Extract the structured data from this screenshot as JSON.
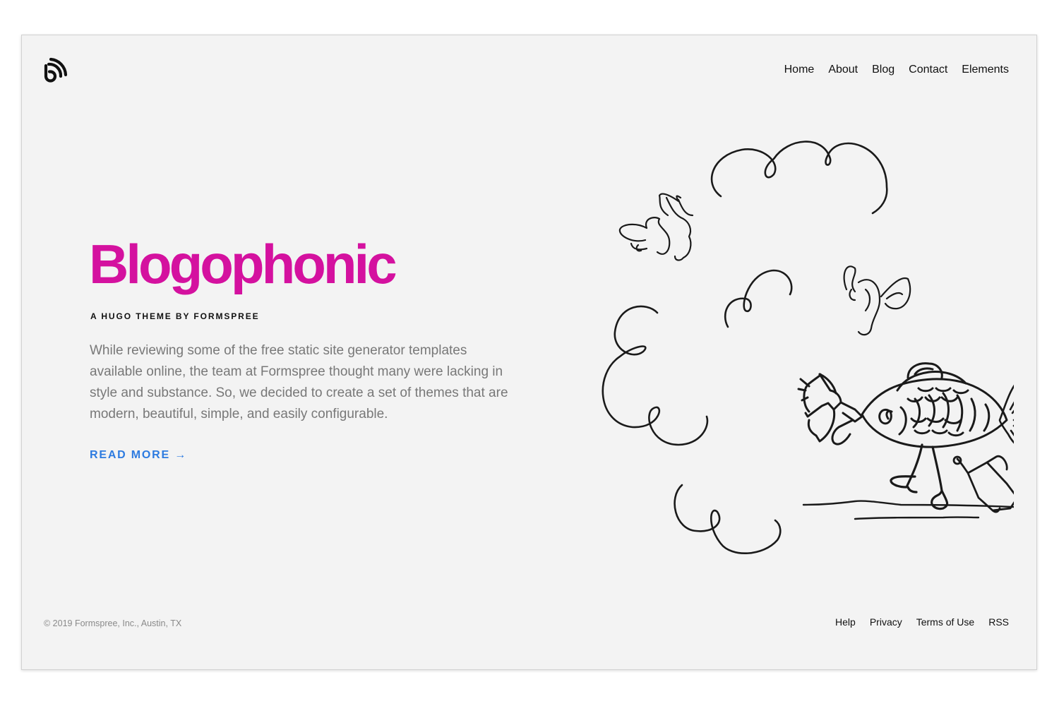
{
  "header": {
    "logo_icon": "rss-feed-icon",
    "nav": [
      {
        "label": "Home"
      },
      {
        "label": "About"
      },
      {
        "label": "Blog"
      },
      {
        "label": "Contact"
      },
      {
        "label": "Elements"
      }
    ]
  },
  "hero": {
    "title": "Blogophonic",
    "subtitle": "A HUGO THEME BY FORMSPREE",
    "description": "While reviewing some of the free static site generator templates available online, the team at Formspree thought many were lacking in style and substance. So, we decided to create a set of themes that are modern, beautiful, simple, and easily configurable.",
    "read_more_label": "READ MORE →"
  },
  "illustration": {
    "icon": "fish-megaphone-illustration"
  },
  "footer": {
    "copyright": "© 2019 Formspree, Inc., Austin, TX",
    "links": [
      {
        "label": "Help"
      },
      {
        "label": "Privacy"
      },
      {
        "label": "Terms of Use"
      },
      {
        "label": "RSS"
      }
    ]
  },
  "colors": {
    "page_background": "#ffffff",
    "frame_background": "#f3f3f3",
    "brand_magenta": "#d4119f",
    "link_blue": "#2d7be0",
    "body_text": "#787878",
    "nav_text": "#111111"
  }
}
